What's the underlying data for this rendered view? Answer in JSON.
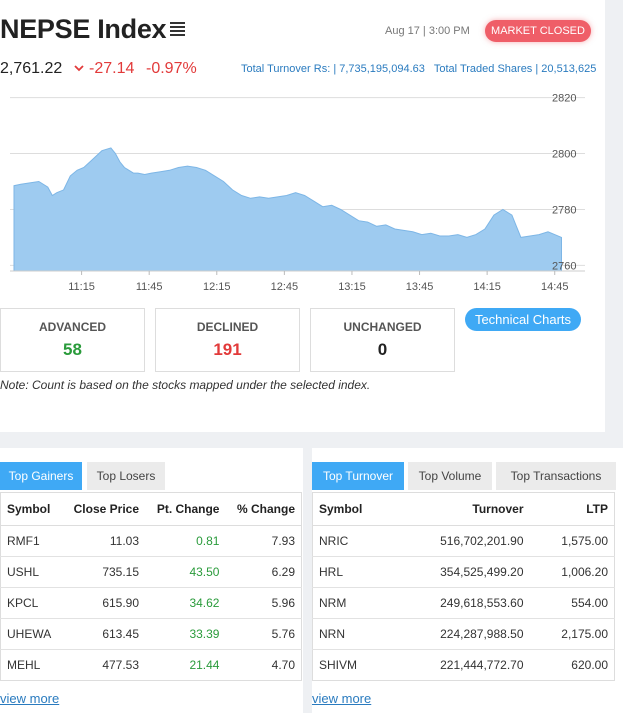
{
  "header": {
    "title": "NEPSE Index",
    "datetime": "Aug 17 | 3:00 PM",
    "market_status": "MARKET CLOSED",
    "index_value": "2,761.22",
    "change": "-27.14",
    "change_percent": "-0.97%",
    "turnover_text": "Total Turnover Rs: | 7,735,195,094.63",
    "traded_shares_text": "Total Traded Shares | 20,513,625"
  },
  "chart_data": {
    "type": "area",
    "x_ticks": [
      "11:15",
      "11:45",
      "12:15",
      "12:45",
      "13:15",
      "13:45",
      "14:15",
      "14:45"
    ],
    "y_ticks": [
      "2820",
      "2800",
      "2780",
      "2760"
    ],
    "ylim": [
      2758,
      2822
    ],
    "x_range_minutes": [
      645,
      890
    ],
    "x": [
      645,
      648,
      652,
      656,
      660,
      662,
      664,
      667,
      670,
      673,
      676,
      680,
      684,
      688,
      690,
      692,
      694,
      696,
      698,
      700,
      703,
      706,
      710,
      714,
      718,
      722,
      726,
      730,
      734,
      738,
      742,
      746,
      750,
      754,
      758,
      762,
      766,
      770,
      774,
      778,
      782,
      786,
      790,
      794,
      798,
      802,
      806,
      810,
      814,
      818,
      822,
      826,
      830,
      834,
      838,
      842,
      846,
      850,
      854,
      858,
      862,
      866,
      868,
      870,
      874,
      878,
      882,
      885,
      888
    ],
    "values": [
      2788.5,
      2789,
      2789.5,
      2790,
      2788,
      2785,
      2786,
      2787,
      2792,
      2794,
      2795,
      2798,
      2801,
      2802,
      2800,
      2797,
      2795,
      2794,
      2793,
      2793,
      2792.5,
      2793,
      2793.5,
      2794,
      2795,
      2795.5,
      2795,
      2794,
      2792,
      2790,
      2787,
      2785,
      2784,
      2784.5,
      2784,
      2784.5,
      2785,
      2786,
      2785,
      2783,
      2781,
      2781.5,
      2780,
      2778,
      2776,
      2775.5,
      2774,
      2774.5,
      2773,
      2772.5,
      2772,
      2771,
      2771.5,
      2770.5,
      2770.5,
      2771,
      2770,
      2771,
      2773,
      2778,
      2780,
      2778,
      2774,
      2770,
      2770.5,
      2771,
      2772,
      2771,
      2770,
      2768,
      2765,
      2763,
      2764,
      2762,
      2763,
      2764,
      2763
    ]
  },
  "stats": {
    "advanced_label": "ADVANCED",
    "advanced_value": "58",
    "declined_label": "DECLINED",
    "declined_value": "191",
    "unchanged_label": "UNCHANGED",
    "unchanged_value": "0"
  },
  "technical_charts_label": "Technical Charts",
  "note": "Note: Count is based on the stocks mapped under the selected index.",
  "colors": {
    "accent": "#3fa9f5",
    "negative": "#e23a3a",
    "positive": "#2a9b3b",
    "badge": "#ef5e68",
    "area_fill": "#9ecbf0"
  },
  "gainers": {
    "tabs": [
      "Top Gainers",
      "Top Losers"
    ],
    "headers": [
      "Symbol",
      "Close Price",
      "Pt. Change",
      "% Change"
    ],
    "rows": [
      [
        "RMF1",
        "11.03",
        "0.81",
        "7.93"
      ],
      [
        "USHL",
        "735.15",
        "43.50",
        "6.29"
      ],
      [
        "KPCL",
        "615.90",
        "34.62",
        "5.96"
      ],
      [
        "UHEWA",
        "613.45",
        "33.39",
        "5.76"
      ],
      [
        "MEHL",
        "477.53",
        "21.44",
        "4.70"
      ]
    ],
    "view_more": "view more"
  },
  "turnover": {
    "tabs": [
      "Top Turnover",
      "Top Volume",
      "Top Transactions"
    ],
    "headers": [
      "Symbol",
      "Turnover",
      "LTP"
    ],
    "rows": [
      [
        "NRIC",
        "516,702,201.90",
        "1,575.00"
      ],
      [
        "HRL",
        "354,525,499.20",
        "1,006.20"
      ],
      [
        "NRM",
        "249,618,553.60",
        "554.00"
      ],
      [
        "NRN",
        "224,287,988.50",
        "2,175.00"
      ],
      [
        "SHIVM",
        "221,444,772.70",
        "620.00"
      ]
    ],
    "view_more": "view more"
  }
}
